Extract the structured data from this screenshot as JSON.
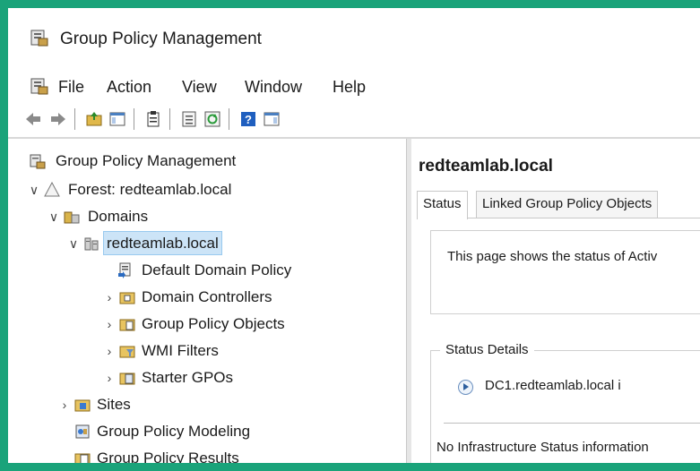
{
  "window": {
    "title": "Group Policy Management"
  },
  "menu": [
    "File",
    "Action",
    "View",
    "Window",
    "Help"
  ],
  "toolbar": [
    "back",
    "forward",
    "up-folder",
    "show-hide-tree",
    "clipboard",
    "properties",
    "refresh",
    "help",
    "show-hide-action-pane"
  ],
  "tree": {
    "root": "Group Policy Management",
    "forest": "Forest: redteamlab.local",
    "domains": "Domains",
    "domain": "redteamlab.local",
    "default_policy": "Default Domain Policy",
    "domain_controllers": "Domain Controllers",
    "gpo": "Group Policy Objects",
    "wmi": "WMI Filters",
    "starter": "Starter GPOs",
    "sites": "Sites",
    "modeling": "Group Policy Modeling",
    "results": "Group Policy Results"
  },
  "right": {
    "title": "redteamlab.local",
    "tabs": [
      "Status",
      "Linked Group Policy Objects"
    ],
    "intro": "This page shows the status of Activ",
    "status_details_label": "Status Details",
    "dc_entry": "DC1.redteamlab.local i",
    "no_info": "No Infrastructure Status information"
  },
  "colors": {
    "frame": "#1aa37a",
    "selection": "#cce4f7"
  }
}
